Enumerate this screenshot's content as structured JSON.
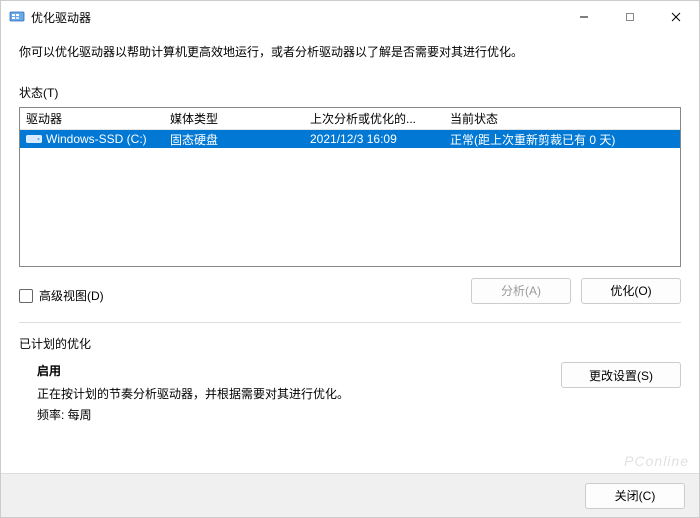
{
  "window": {
    "title": "优化驱动器"
  },
  "description": "你可以优化驱动器以帮助计算机更高效地运行，或者分析驱动器以了解是否需要对其进行优化。",
  "status_label": "状态(T)",
  "columns": {
    "drive": "驱动器",
    "media": "媒体类型",
    "last": "上次分析或优化的...",
    "state": "当前状态"
  },
  "drives": [
    {
      "name": "Windows-SSD (C:)",
      "media": "固态硬盘",
      "last": "2021/12/3 16:09",
      "state": "正常(距上次重新剪裁已有 0 天)",
      "selected": true
    }
  ],
  "advanced_view_label": "高级视图(D)",
  "buttons": {
    "analyze": "分析(A)",
    "optimize": "优化(O)",
    "change_settings": "更改设置(S)",
    "close": "关闭(C)"
  },
  "schedule": {
    "title": "已计划的优化",
    "enable": "启用",
    "desc": "正在按计划的节奏分析驱动器，并根据需要对其进行优化。",
    "freq": "频率: 每周"
  },
  "watermark": "PConline"
}
